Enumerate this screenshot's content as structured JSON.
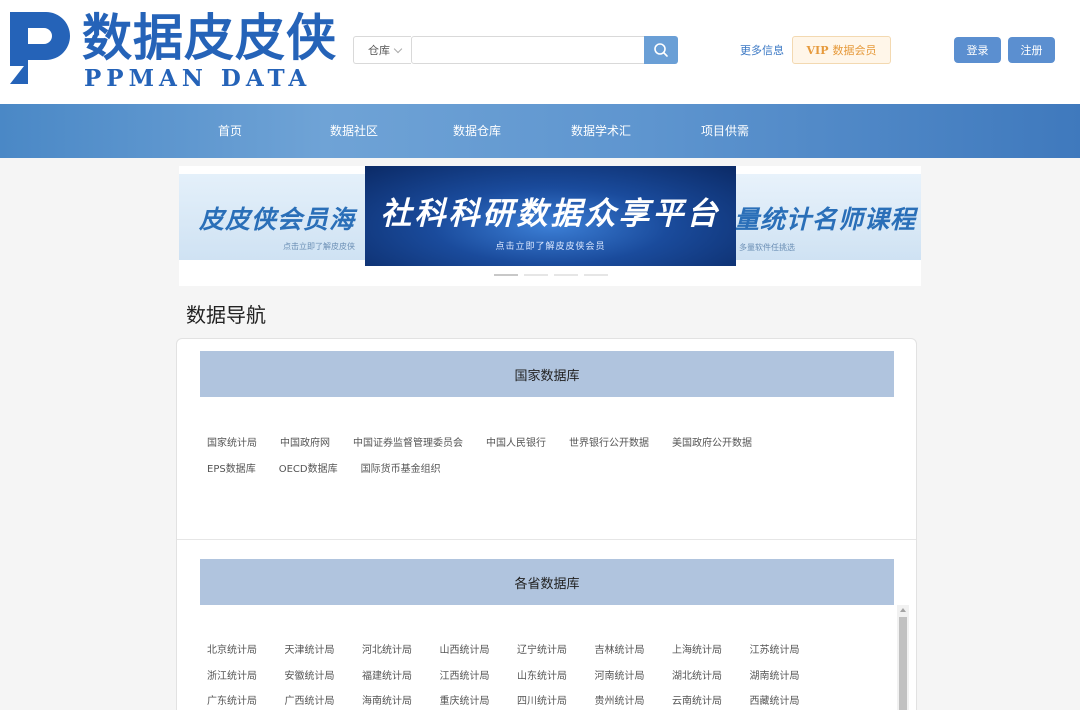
{
  "logo": {
    "title": "数据皮皮侠",
    "subtitle": "PPMAN DATA",
    "brand_color": "#2563b8"
  },
  "search": {
    "scope_value": "仓库",
    "query": "",
    "placeholder": "",
    "button_icon": "search-icon"
  },
  "header_links": {
    "more_info": "更多信息",
    "vip_prefix": "VIP",
    "vip_label": "数据会员",
    "login": "登录",
    "register": "注册"
  },
  "nav": {
    "items": [
      {
        "label": "首页"
      },
      {
        "label": "数据社区"
      },
      {
        "label": "数据仓库"
      },
      {
        "label": "数据学术汇"
      },
      {
        "label": "项目供需"
      }
    ]
  },
  "banner": {
    "left_title": "皮皮侠会员海",
    "left_caption": "点击立即了解皮皮侠",
    "center_title": "社科科研数据众享平台",
    "center_caption": "点击立即了解皮皮侠会员",
    "right_title": "量统计名师课程",
    "right_caption": "多量软件任挑选",
    "slide_count": 4,
    "active_slide": 1
  },
  "data_nav": {
    "title": "数据导航",
    "categories": [
      {
        "name": "国家数据库",
        "links": [
          [
            "国家统计局",
            "中国政府网",
            "中国证券监督管理委员会",
            "中国人民银行",
            "世界银行公开数据",
            "美国政府公开数据"
          ],
          [
            "EPS数据库",
            "OECD数据库",
            "国际货币基金组织"
          ]
        ]
      },
      {
        "name": "各省数据库",
        "links": [
          [
            "北京统计局",
            "天津统计局",
            "河北统计局",
            "山西统计局",
            "辽宁统计局",
            "吉林统计局",
            "上海统计局",
            "江苏统计局"
          ],
          [
            "浙江统计局",
            "安徽统计局",
            "福建统计局",
            "江西统计局",
            "山东统计局",
            "河南统计局",
            "湖北统计局",
            "湖南统计局"
          ],
          [
            "广东统计局",
            "广西统计局",
            "海南统计局",
            "重庆统计局",
            "四川统计局",
            "贵州统计局",
            "云南统计局",
            "西藏统计局"
          ]
        ]
      }
    ]
  },
  "colors": {
    "nav_gradient_start": "#4a88c6",
    "nav_gradient_end": "#3f79bd",
    "category_header_bg": "#b0c4de",
    "button_blue": "#5b8fd0",
    "vip_text": "#e69a3c"
  }
}
